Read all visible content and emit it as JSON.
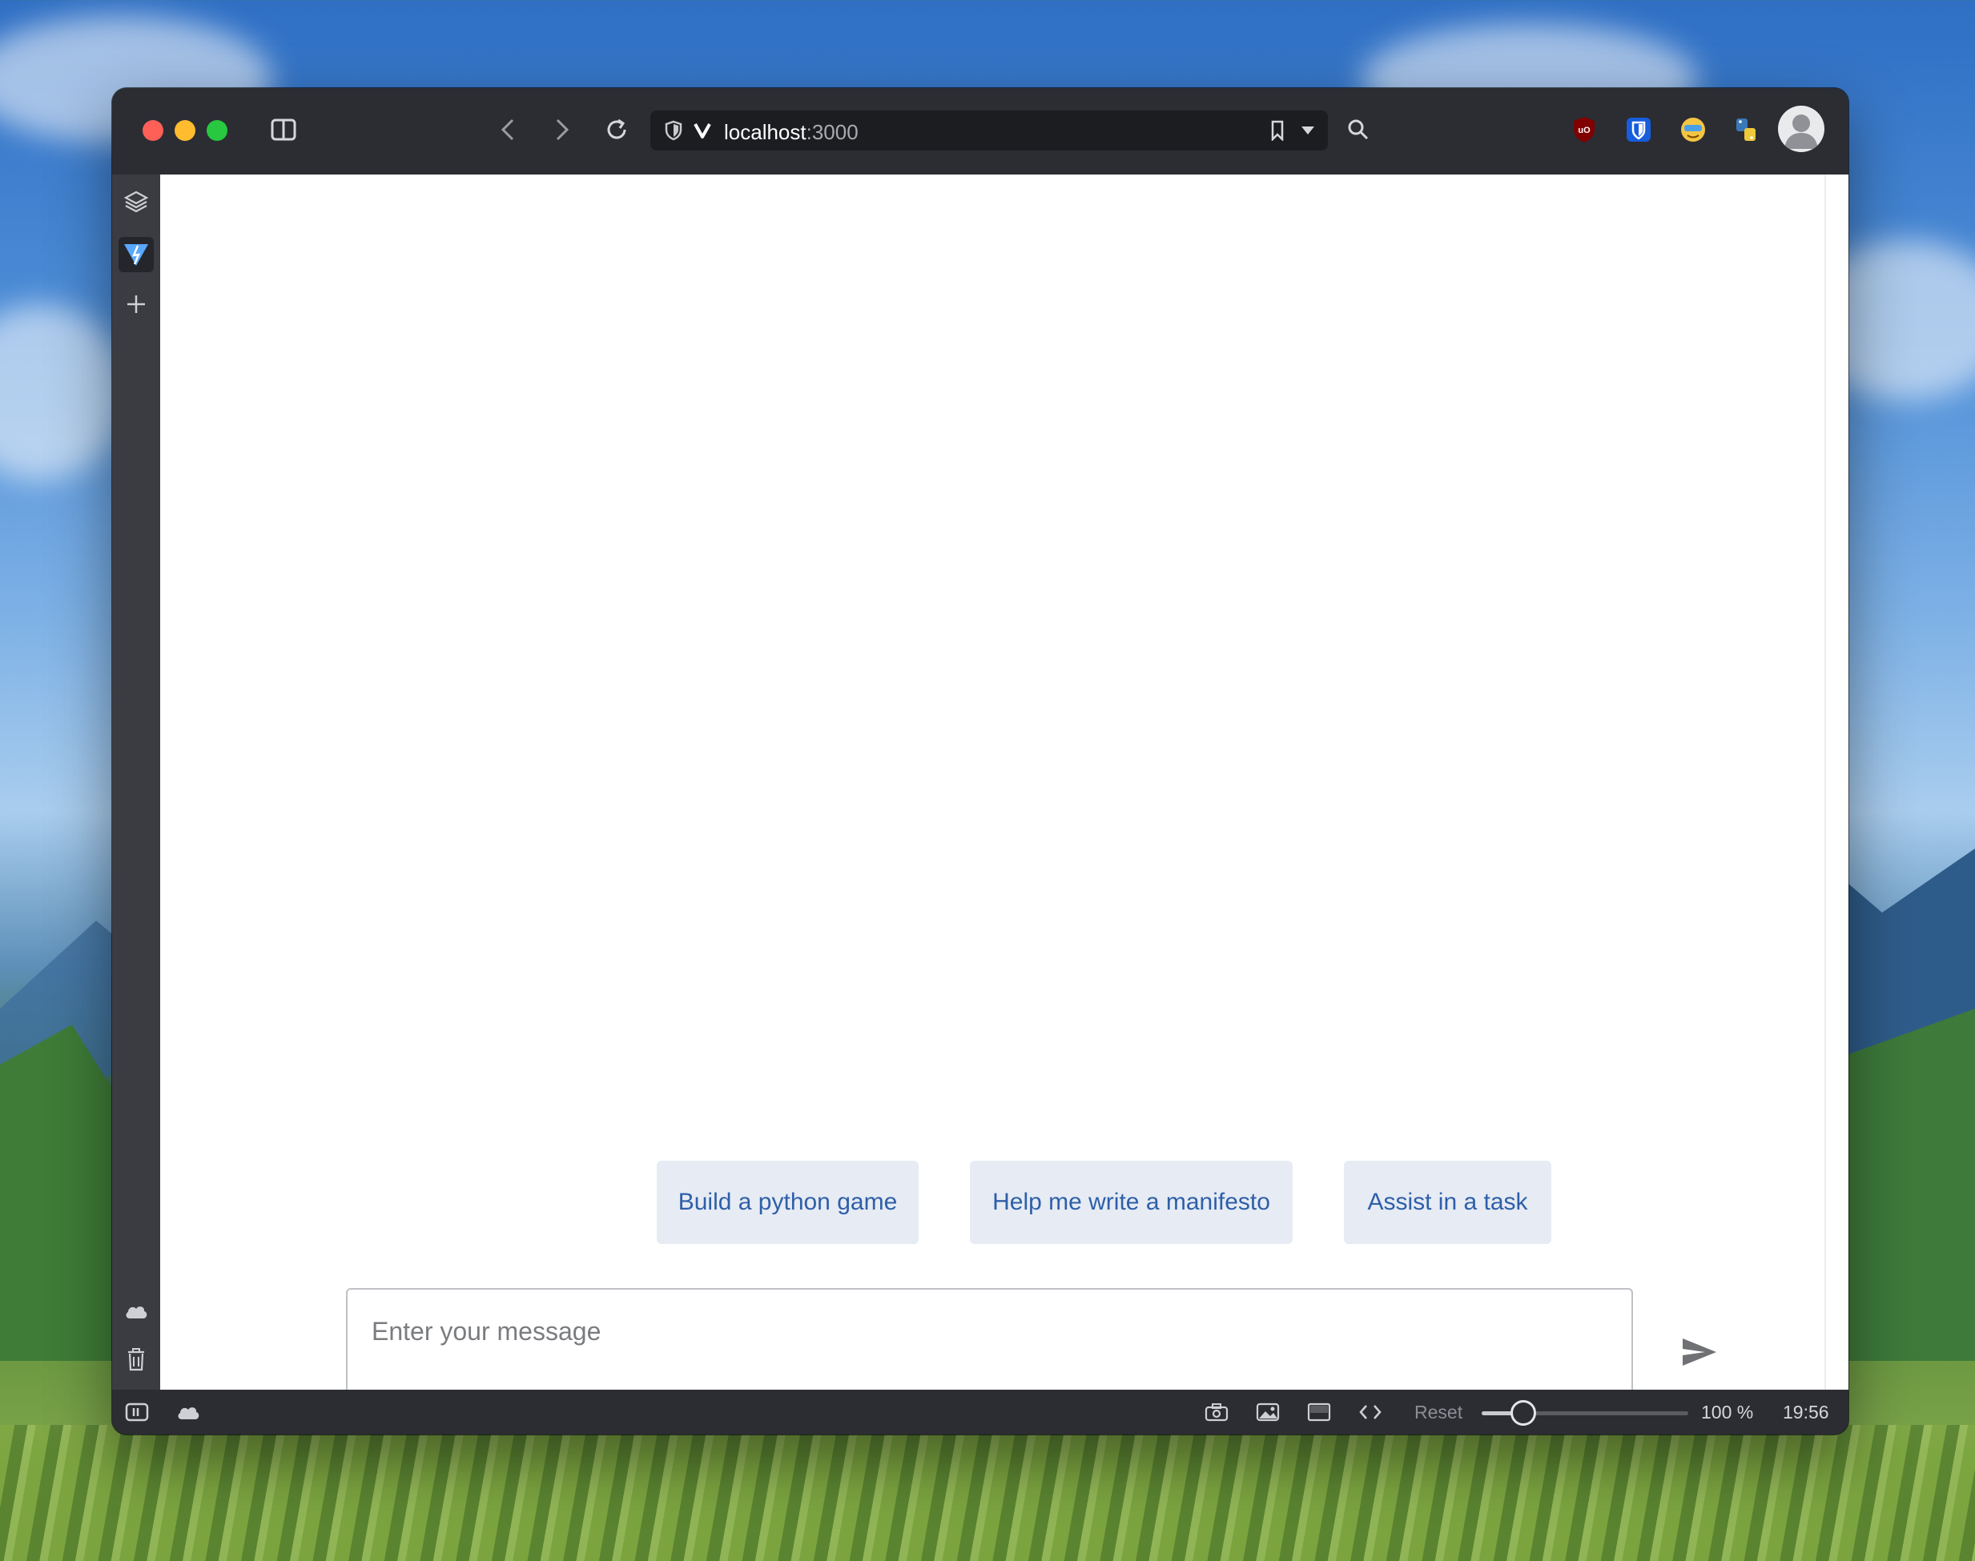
{
  "browser": {
    "address": {
      "host": "localhost",
      "port": ":3000"
    },
    "extensions": [
      "ublock-origin-icon",
      "bitwarden-icon",
      "smiley-extension-icon",
      "python-extension-icon"
    ],
    "profile": "avatar"
  },
  "chat": {
    "suggestions": [
      {
        "label": "Build a python game"
      },
      {
        "label": "Help me write a manifesto"
      },
      {
        "label": "Assist in a task"
      }
    ],
    "input": {
      "placeholder": "Enter your message",
      "value": ""
    }
  },
  "statusbar": {
    "reset_label": "Reset",
    "zoom_label": "100 %",
    "zoom_level_fraction": 0.2,
    "clock": "19:56"
  },
  "colors": {
    "chrome": "#2b2d33",
    "suggestion_bg": "#e6ebf4",
    "suggestion_text": "#2e5fa8",
    "accent_blue": "#3a7bd5"
  }
}
